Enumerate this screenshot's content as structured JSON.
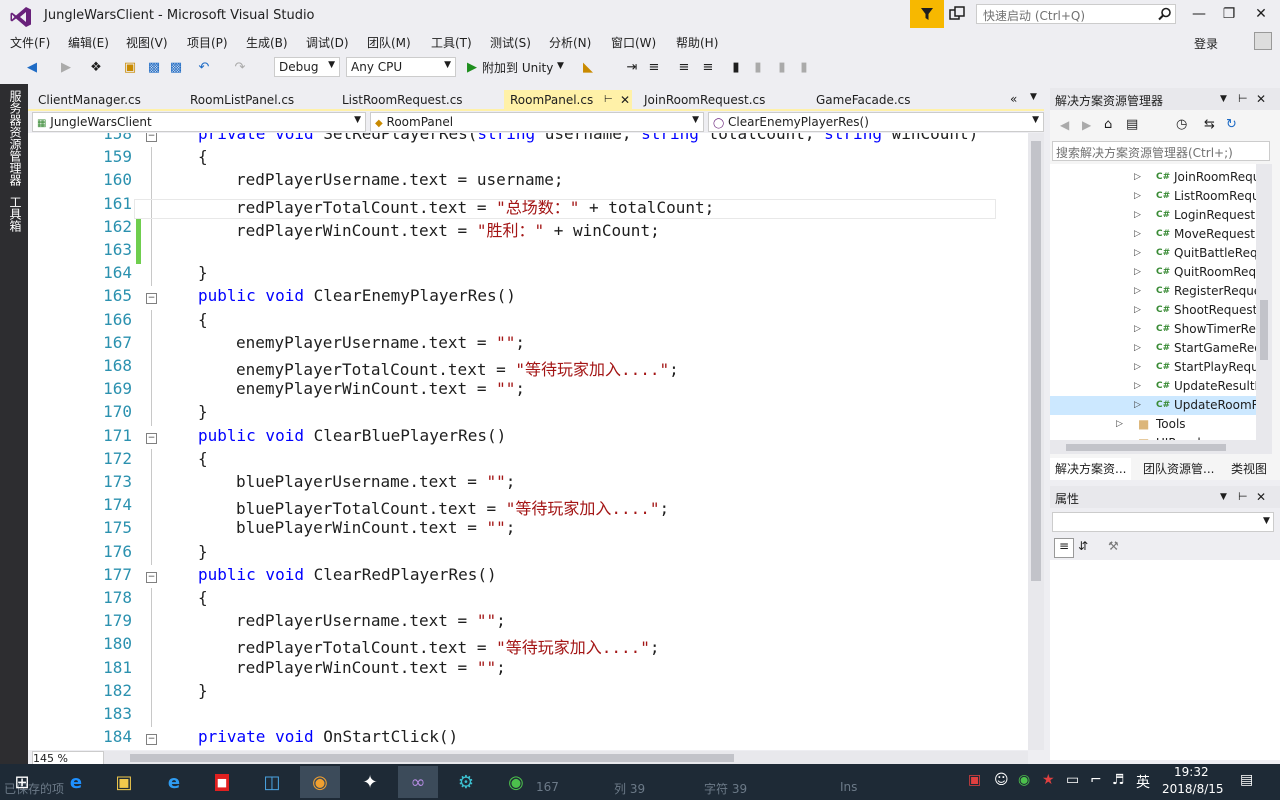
{
  "window": {
    "title": "JungleWarsClient - Microsoft Visual Studio",
    "quick_launch_placeholder": "快速启动 (Ctrl+Q)",
    "login": "登录"
  },
  "menu": [
    "文件(F)",
    "编辑(E)",
    "视图(V)",
    "项目(P)",
    "生成(B)",
    "调试(D)",
    "团队(M)",
    "工具(T)",
    "测试(S)",
    "分析(N)",
    "窗口(W)",
    "帮助(H)"
  ],
  "toolbar": {
    "config": "Debug",
    "platform": "Any CPU",
    "attach": "附加到 Unity"
  },
  "left_tabs": [
    "服务器资源管理器",
    "工具箱"
  ],
  "doc_tabs": [
    "ClientManager.cs",
    "RoomListPanel.cs",
    "ListRoomRequest.cs",
    "RoomPanel.cs",
    "JoinRoomRequest.cs",
    "GameFacade.cs"
  ],
  "nav": {
    "project": "JungleWarsClient",
    "class": "RoomPanel",
    "member": "ClearEnemyPlayerRes()"
  },
  "code": {
    "lines": [
      {
        "n": "158",
        "t": [
          {
            "k": "kw",
            "s": "private void "
          },
          {
            "s": "SetRedPlayerRes("
          },
          {
            "k": "kw",
            "s": "string"
          },
          {
            "s": " username, "
          },
          {
            "k": "kw",
            "s": "string"
          },
          {
            "s": " totalCount, "
          },
          {
            "k": "kw",
            "s": "string"
          },
          {
            "s": " winCount)"
          }
        ],
        "i": 0
      },
      {
        "n": "159",
        "t": [
          {
            "s": "{"
          }
        ],
        "i": 0
      },
      {
        "n": "160",
        "t": [
          {
            "s": "redPlayerUsername.text = username;"
          }
        ],
        "i": 1
      },
      {
        "n": "161",
        "t": [
          {
            "s": "redPlayerTotalCount.text = "
          },
          {
            "k": "str",
            "s": "\"总场数：\""
          },
          {
            "s": " + totalCount;"
          }
        ],
        "i": 1
      },
      {
        "n": "162",
        "t": [
          {
            "s": "redPlayerWinCount.text = "
          },
          {
            "k": "str",
            "s": "\"胜利：\""
          },
          {
            "s": " + winCount;"
          }
        ],
        "i": 1
      },
      {
        "n": "163",
        "t": [],
        "i": 0
      },
      {
        "n": "164",
        "t": [
          {
            "s": "}"
          }
        ],
        "i": 0
      },
      {
        "n": "165",
        "t": [
          {
            "k": "kw",
            "s": "public void "
          },
          {
            "s": "ClearEnemyPlayerRes()"
          }
        ],
        "i": 0
      },
      {
        "n": "166",
        "t": [
          {
            "s": "{"
          }
        ],
        "i": 0
      },
      {
        "n": "167",
        "t": [
          {
            "s": "enemyPlayerUsername.text = "
          },
          {
            "k": "str",
            "s": "\"\""
          },
          {
            "s": ";"
          }
        ],
        "i": 1
      },
      {
        "n": "168",
        "t": [
          {
            "s": "enemyPlayerTotalCount.text = "
          },
          {
            "k": "str",
            "s": "\"等待玩家加入....\""
          },
          {
            "s": ";"
          }
        ],
        "i": 1
      },
      {
        "n": "169",
        "t": [
          {
            "s": "enemyPlayerWinCount.text = "
          },
          {
            "k": "str",
            "s": "\"\""
          },
          {
            "s": ";"
          }
        ],
        "i": 1
      },
      {
        "n": "170",
        "t": [
          {
            "s": "}"
          }
        ],
        "i": 0
      },
      {
        "n": "171",
        "t": [
          {
            "k": "kw",
            "s": "public void "
          },
          {
            "s": "ClearBluePlayerRes()"
          }
        ],
        "i": 0
      },
      {
        "n": "172",
        "t": [
          {
            "s": "{"
          }
        ],
        "i": 0
      },
      {
        "n": "173",
        "t": [
          {
            "s": "bluePlayerUsername.text = "
          },
          {
            "k": "str",
            "s": "\"\""
          },
          {
            "s": ";"
          }
        ],
        "i": 1
      },
      {
        "n": "174",
        "t": [
          {
            "s": "bluePlayerTotalCount.text = "
          },
          {
            "k": "str",
            "s": "\"等待玩家加入....\""
          },
          {
            "s": ";"
          }
        ],
        "i": 1
      },
      {
        "n": "175",
        "t": [
          {
            "s": "bluePlayerWinCount.text = "
          },
          {
            "k": "str",
            "s": "\"\""
          },
          {
            "s": ";"
          }
        ],
        "i": 1
      },
      {
        "n": "176",
        "t": [
          {
            "s": "}"
          }
        ],
        "i": 0
      },
      {
        "n": "177",
        "t": [
          {
            "k": "kw",
            "s": "public void "
          },
          {
            "s": "ClearRedPlayerRes()"
          }
        ],
        "i": 0
      },
      {
        "n": "178",
        "t": [
          {
            "s": "{"
          }
        ],
        "i": 0
      },
      {
        "n": "179",
        "t": [
          {
            "s": "redPlayerUsername.text = "
          },
          {
            "k": "str",
            "s": "\"\""
          },
          {
            "s": ";"
          }
        ],
        "i": 1
      },
      {
        "n": "180",
        "t": [
          {
            "s": "redPlayerTotalCount.text = "
          },
          {
            "k": "str",
            "s": "\"等待玩家加入....\""
          },
          {
            "s": ";"
          }
        ],
        "i": 1
      },
      {
        "n": "181",
        "t": [
          {
            "s": "redPlayerWinCount.text = "
          },
          {
            "k": "str",
            "s": "\"\""
          },
          {
            "s": ";"
          }
        ],
        "i": 1
      },
      {
        "n": "182",
        "t": [
          {
            "s": "}"
          }
        ],
        "i": 0
      },
      {
        "n": "183",
        "t": [],
        "i": 0
      },
      {
        "n": "184",
        "t": [
          {
            "k": "kw",
            "s": "private void "
          },
          {
            "s": "OnStartClick()"
          }
        ],
        "i": 0
      }
    ]
  },
  "zoom": "145 %",
  "solution_explorer": {
    "title": "解决方案资源管理器",
    "search_placeholder": "搜索解决方案资源管理器(Ctrl+;)",
    "cs_label": "C#",
    "items": [
      "JoinRoomRequest.cs",
      "ListRoomRequest.cs",
      "LoginRequest.cs",
      "MoveRequest.cs",
      "QuitBattleRequest.cs",
      "QuitRoomRequest.cs",
      "RegisterRequest.cs",
      "ShootRequest.cs",
      "ShowTimerRequest.cs",
      "StartGameRequest.cs",
      "StartPlayRequest.cs",
      "UpdateResultRequest.cs",
      "UpdateRoomRequest.cs"
    ],
    "folder": "Tools",
    "partial": "UIPanel",
    "bottom_tabs": [
      "解决方案资...",
      "团队资源管...",
      "类视图"
    ]
  },
  "properties": {
    "title": "属性"
  },
  "status_faint": {
    "left": "已保存的项",
    "line": "167",
    "col": "列 39",
    "ch": "字符 39",
    "ins": "Ins"
  },
  "taskbar": {
    "lang": "英",
    "time": "19:32",
    "date": "2018/8/15"
  },
  "colors": {
    "vs_purple": "#68217a",
    "accent_yellow": "#fff1a8",
    "keyword": "#0000ff",
    "string": "#a31515",
    "linenum": "#2b91af"
  }
}
